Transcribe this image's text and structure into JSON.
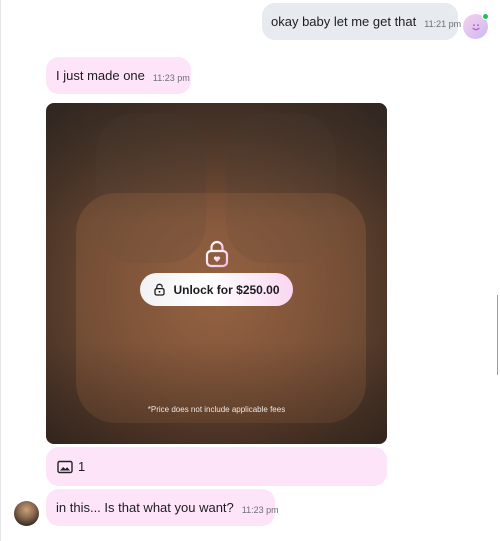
{
  "messages": {
    "outgoing_1": {
      "text": "okay baby let me get that",
      "time": "11:21 pm"
    },
    "incoming_1": {
      "text": "I just made one",
      "time": "11:23 pm"
    },
    "incoming_2": {
      "text": "in this... Is that what you want?",
      "time": "11:23 pm"
    }
  },
  "locked_media": {
    "unlock_label": "Unlock for $250.00",
    "price_note": "*Price does not include applicable fees",
    "media_count": "1"
  },
  "icons": {
    "self_avatar": "smiley-avatar-icon",
    "lock": "heart-lock-icon",
    "unlock": "padlock-icon",
    "media": "image-icon"
  },
  "colors": {
    "incoming_bubble": "#fde4f9",
    "outgoing_bubble": "#e7ebf0",
    "online_status": "#1fbf5b"
  }
}
